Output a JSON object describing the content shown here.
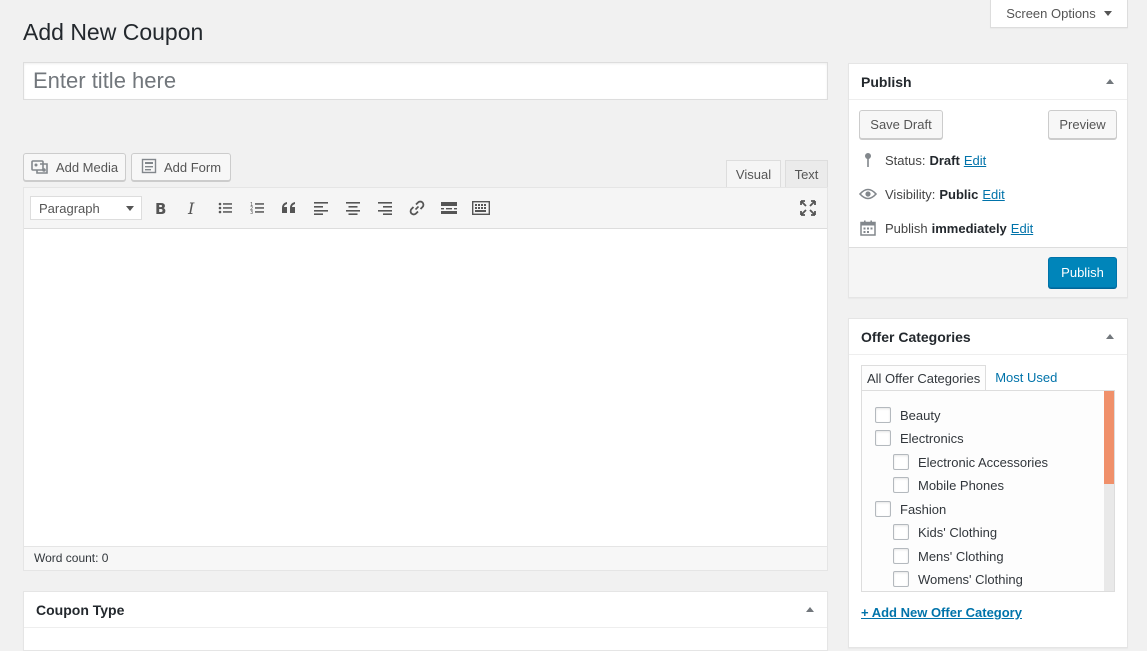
{
  "header": {
    "title": "Add New Coupon",
    "screen_options_label": "Screen Options"
  },
  "title_field": {
    "placeholder": "Enter title here",
    "value": ""
  },
  "media_buttons": {
    "add_media": "Add Media",
    "add_form": "Add Form"
  },
  "editor": {
    "tabs": {
      "visual": "Visual",
      "text": "Text"
    },
    "format_select": "Paragraph",
    "toolbar_icons": [
      "bold-icon",
      "italic-icon",
      "bullet-list-icon",
      "numbered-list-icon",
      "blockquote-icon",
      "align-left-icon",
      "align-center-icon",
      "align-right-icon",
      "link-icon",
      "read-more-icon",
      "toolbar-toggle-icon",
      "fullscreen-icon"
    ],
    "word_count": "Word count: 0"
  },
  "coupon_type": {
    "title": "Coupon Type"
  },
  "publish": {
    "title": "Publish",
    "save_draft": "Save Draft",
    "preview": "Preview",
    "status_label": "Status:",
    "status_value": "Draft",
    "visibility_label": "Visibility:",
    "visibility_value": "Public",
    "schedule_label": "Publish",
    "schedule_value": "immediately",
    "edit": "Edit",
    "publish_button": "Publish"
  },
  "offer_categories": {
    "title": "Offer Categories",
    "tab_all": "All Offer Categories",
    "tab_most_used": "Most Used",
    "items": [
      {
        "label": "Beauty",
        "level": 0,
        "checked": false
      },
      {
        "label": "Electronics",
        "level": 0,
        "checked": false
      },
      {
        "label": "Electronic Accessories",
        "level": 1,
        "checked": false
      },
      {
        "label": "Mobile Phones",
        "level": 1,
        "checked": false
      },
      {
        "label": "Fashion",
        "level": 0,
        "checked": false
      },
      {
        "label": "Kids' Clothing",
        "level": 1,
        "checked": false
      },
      {
        "label": "Mens' Clothing",
        "level": 1,
        "checked": false
      },
      {
        "label": "Womens' Clothing",
        "level": 1,
        "checked": false
      }
    ],
    "add_new_link": "+ Add New Offer Category"
  },
  "colors": {
    "background": "#f1f1f1",
    "primary_button": "#0085ba",
    "link": "#0073aa",
    "scrollbar_thumb": "#f0906a"
  }
}
